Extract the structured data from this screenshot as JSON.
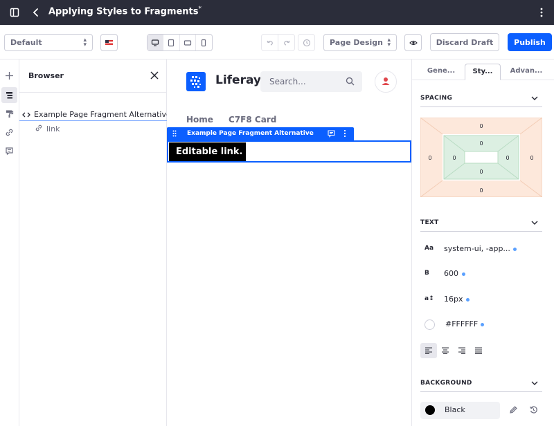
{
  "topbar": {
    "title": "Applying Styles to Fragments",
    "draft_marker": "*"
  },
  "toolbar": {
    "experience_select": "Default",
    "language": "en-US",
    "page_design_select": "Page Design",
    "discard_label": "Discard Draft",
    "publish_label": "Publish"
  },
  "browser": {
    "title": "Browser",
    "tree": {
      "fragment_label": "Example Page Fragment Alternative",
      "child_label": "link"
    }
  },
  "canvas": {
    "brand": "Liferay",
    "search_placeholder": "Search...",
    "nav": [
      "Home",
      "C7F8 Card"
    ],
    "fragment_toolbar_label": "Example Page Fragment Alternative",
    "editable_link_text": "Editable link."
  },
  "panel": {
    "tabs": [
      "Gene...",
      "Sty...",
      "Advan..."
    ],
    "active_tab": 1,
    "spacing": {
      "title": "SPACING",
      "margin": {
        "top": "0",
        "right": "0",
        "bottom": "0",
        "left": "0"
      },
      "padding": {
        "top": "0",
        "right": "0",
        "bottom": "0",
        "left": "0"
      }
    },
    "text": {
      "title": "TEXT",
      "font_family_icon": "Aa",
      "font_family": "system-ui, -app...",
      "font_weight_icon": "B",
      "font_weight": "600",
      "font_size_icon": "a↕",
      "font_size": "16px",
      "color": "#FFFFFF",
      "text_align": "left"
    },
    "background": {
      "title": "BACKGROUND",
      "color_name": "Black",
      "color": "#000000"
    }
  },
  "colors": {
    "primary": "#0b5fff",
    "topbar": "#2b2d3a",
    "margin_fill": "#fde8db",
    "padding_fill": "#dcefe2"
  }
}
